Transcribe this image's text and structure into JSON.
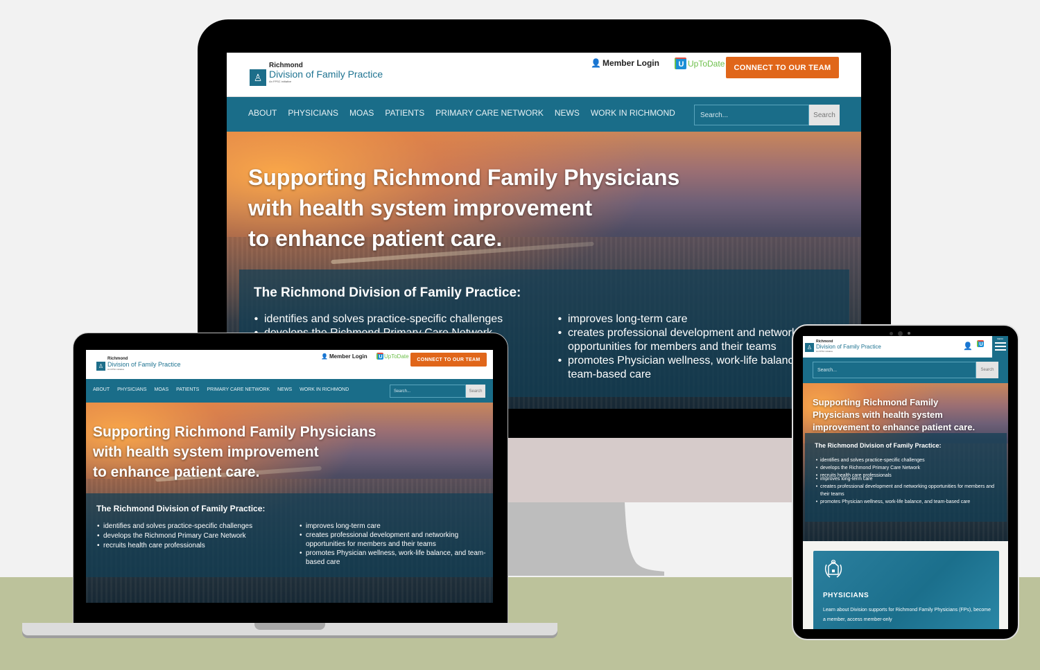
{
  "site": {
    "logo": {
      "top": "Richmond",
      "main": "Division of Family Practice",
      "sub": "An FPSC initiative",
      "icon": "family-practice-logo-icon"
    },
    "member_login": "Member Login",
    "member_login_icon": "member-lock-icon",
    "uptodate_label": "UpToDate",
    "uptodate_icon_letter": "U",
    "connect_button": "CONNECT TO OUR TEAM",
    "nav": [
      "ABOUT",
      "PHYSICIANS",
      "MOAS",
      "PATIENTS",
      "PRIMARY CARE NETWORK",
      "NEWS",
      "WORK IN RICHMOND"
    ],
    "search": {
      "placeholder": "Search...",
      "button": "Search"
    },
    "hero": {
      "title_lines_wide": [
        "Supporting Richmond Family Physicians",
        "with health system improvement",
        "to enhance patient care."
      ],
      "title_lines_narrow": [
        "Supporting Richmond Family",
        "Physicians with health system",
        "improvement to enhance patient care."
      ]
    },
    "info": {
      "title": "The Richmond Division of Family Practice:",
      "left_bullets": [
        "identifies and solves practice-specific challenges",
        "develops the Richmond Primary Care Network",
        "recruits health care professionals"
      ],
      "right_bullets": [
        "improves long-term care",
        "creates professional development and networking opportunities for members and their teams",
        "promotes Physician wellness, work-life balance, and team-based care"
      ]
    },
    "mobile_menu_label": "MENU",
    "physicians_card": {
      "icon": "stethoscope-house-icon",
      "title": "PHYSICIANS",
      "text": "Learn about Division supports for Richmond Family Physicians (FPs), become a member, access member-only"
    }
  },
  "colors": {
    "brand_teal": "#1a6d89",
    "accent_orange": "#e0661a",
    "floor": "#bcc29b",
    "background": "#f2f2f2"
  }
}
